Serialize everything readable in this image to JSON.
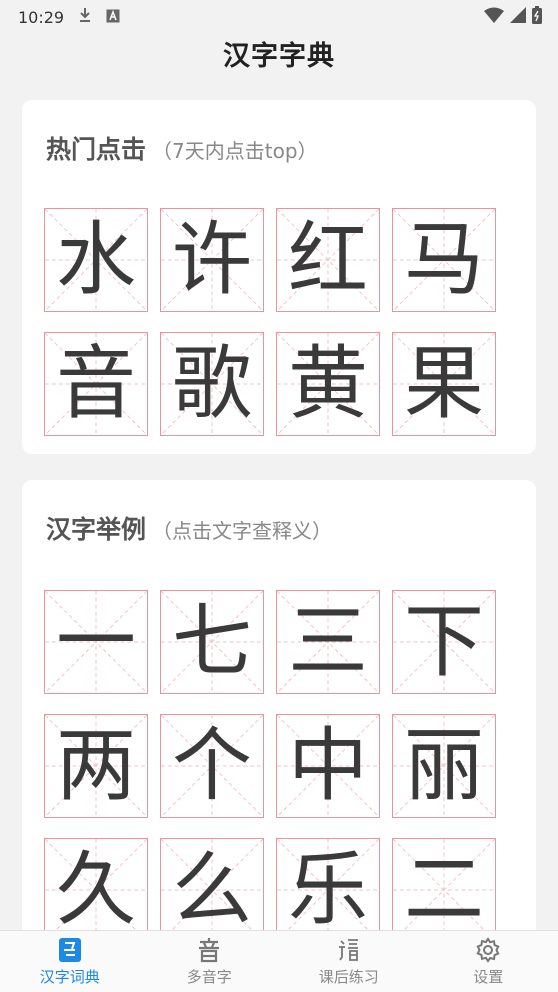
{
  "status": {
    "time": "10:29"
  },
  "app": {
    "title": "汉字字典"
  },
  "hot": {
    "title": "热门点击",
    "subtitle": "（7天内点击top）",
    "chars": [
      "水",
      "许",
      "红",
      "马",
      "音",
      "歌",
      "黄",
      "果"
    ]
  },
  "examples": {
    "title": "汉字举例",
    "subtitle": "（点击文字查释义）",
    "chars": [
      "一",
      "七",
      "三",
      "下",
      "两",
      "个",
      "中",
      "丽",
      "久",
      "么",
      "乐",
      "二"
    ]
  },
  "tabs": [
    {
      "label": "汉字词典",
      "icon": "dictionary-icon",
      "active": true
    },
    {
      "label": "多音字",
      "icon": "polyphone-icon",
      "active": false
    },
    {
      "label": "课后练习",
      "icon": "exercise-icon",
      "active": false
    },
    {
      "label": "设置",
      "icon": "gear-icon",
      "active": false
    }
  ],
  "colors": {
    "accent": "#1e88e5",
    "grid_border": "#e6949d",
    "guide_line": "#f3c2c7"
  }
}
